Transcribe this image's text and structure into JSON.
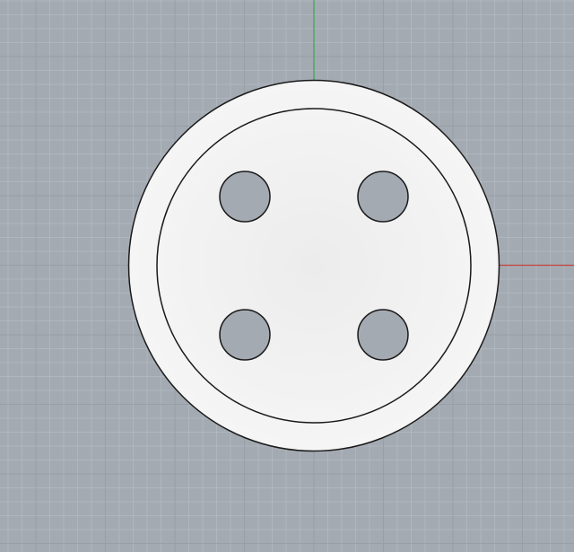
{
  "viewport": {
    "view": "top",
    "background_color": "#a4aab2",
    "grid": {
      "visible": true,
      "minor_color": "#b4bac1",
      "major_color": "#999fa7"
    },
    "axes": {
      "x_axis_color": "#c3443c",
      "y_axis_color": "#3ea64f"
    }
  },
  "model": {
    "name": "button",
    "hole_count": 4,
    "face_color": "#efefef",
    "outline_color": "#1a1a1a"
  }
}
